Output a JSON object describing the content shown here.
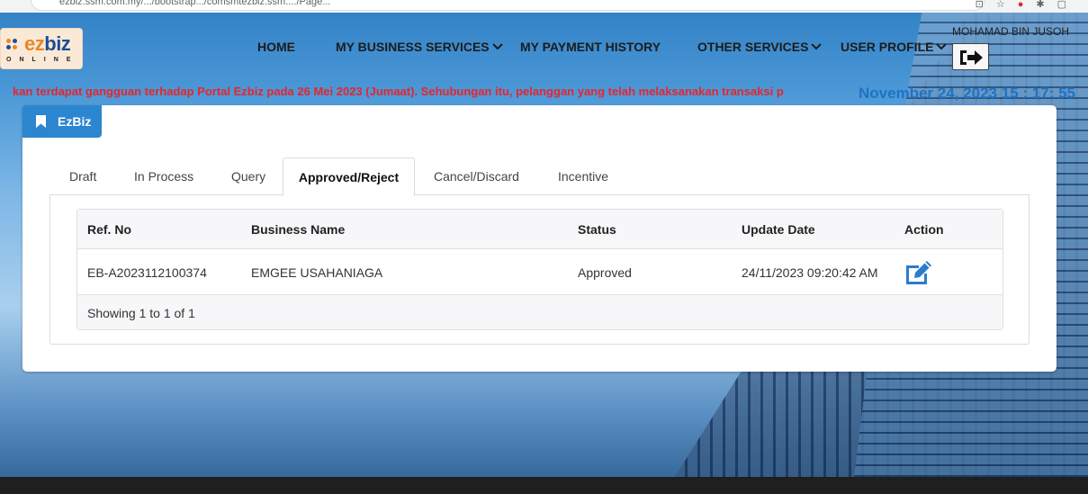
{
  "browser": {
    "url": "ezbiz.ssm.com.my/.../bootstrap.../comsmtezbiz.ssm..../Page...",
    "icons": [
      "share-icon",
      "star-icon",
      "extension-icon",
      "puzzle-icon",
      "window-icon"
    ]
  },
  "brand": {
    "logo_main": "ezbiz",
    "logo_sub": "ONLINE",
    "colors": {
      "blue": "#1b4f93",
      "orange": "#e8872b"
    }
  },
  "nav": {
    "home": "HOME",
    "my_business_services": "MY BUSINESS SERVICES",
    "my_payment_history": "MY PAYMENT HISTORY",
    "other_services": "OTHER SERVICES",
    "user_profile": "USER PROFILE"
  },
  "user": {
    "name": "MOHAMAD BIN JUSOH"
  },
  "announcement": "kan terdapat gangguan terhadap Portal Ezbiz pada 26 Mei 2023 (Jumaat). Sehubungan itu, pelanggan yang telah melaksanakan transaksi p",
  "datetime": "November 24, 2023 15 : 17: 55",
  "card": {
    "title": "EzBiz",
    "accent": "#2b86cf"
  },
  "tabs": [
    {
      "label": "Draft"
    },
    {
      "label": "In Process"
    },
    {
      "label": "Query"
    },
    {
      "label": "Approved/Reject",
      "active": true
    },
    {
      "label": "Cancel/Discard"
    },
    {
      "label": "Incentive"
    }
  ],
  "table": {
    "columns": [
      "Ref. No",
      "Business Name",
      "Status",
      "Update Date",
      "Action"
    ],
    "rows": [
      {
        "ref_no": "EB-A2023112100374",
        "business_name": "EMGEE USAHANIAGA",
        "status": "Approved",
        "update_date": "24/11/2023 09:20:42 AM",
        "action_icon": "edit-icon"
      }
    ],
    "footer": "Showing 1 to 1 of 1"
  }
}
